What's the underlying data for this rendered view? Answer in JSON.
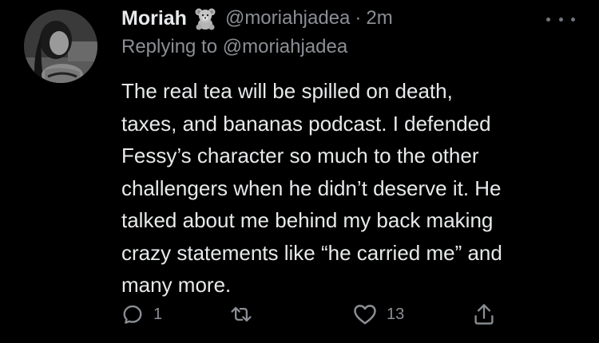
{
  "author": {
    "display_name": "Moriah",
    "handle": "@moriahjadea",
    "name_emoji_icon": "teddy-bear-icon"
  },
  "meta": {
    "separator": "·",
    "timestamp": "2m"
  },
  "reply": {
    "prefix": "Replying to",
    "handle": "@moriahjadea"
  },
  "body": {
    "lines": [
      "The real tea will be spilled on death,",
      "taxes, and bananas podcast. I defended",
      "Fessy’s character so much to the other",
      "challengers when he didn’t deserve it. He",
      "talked about me behind my back making",
      "crazy statements like “he carried me” and",
      "many more."
    ]
  },
  "actions": {
    "reply_count": "1",
    "retweet_count": "",
    "like_count": "13"
  },
  "icons": {
    "more": "more-horizontal-icon",
    "reply": "reply-icon",
    "retweet": "retweet-icon",
    "like": "heart-icon",
    "share": "share-icon"
  },
  "colors": {
    "background": "#000000",
    "primary_text": "#e7e9ea",
    "secondary_text": "#8b8f94"
  }
}
